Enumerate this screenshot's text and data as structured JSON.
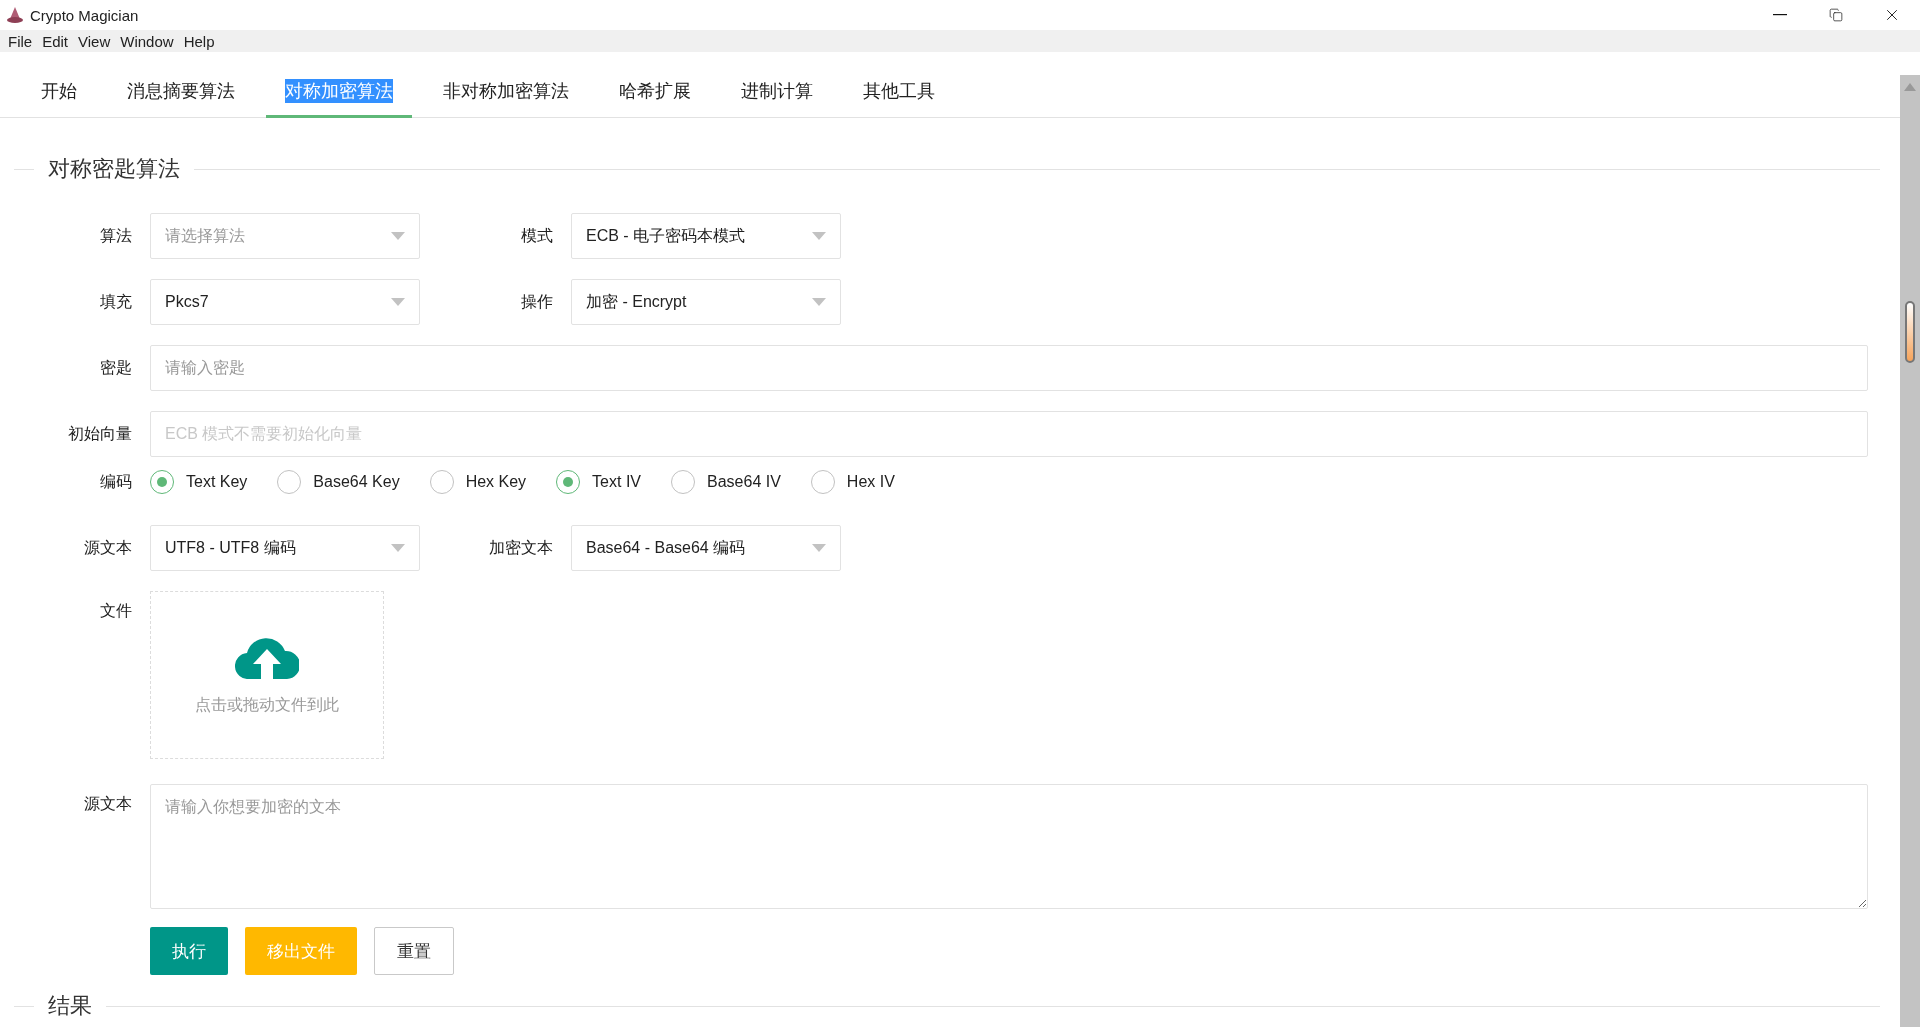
{
  "window": {
    "title": "Crypto Magician"
  },
  "menu": [
    "File",
    "Edit",
    "View",
    "Window",
    "Help"
  ],
  "tabs": [
    {
      "label": "开始",
      "selected": false
    },
    {
      "label": "消息摘要算法",
      "selected": false
    },
    {
      "label": "对称加密算法",
      "selected": true
    },
    {
      "label": "非对称加密算法",
      "selected": false
    },
    {
      "label": "哈希扩展",
      "selected": false
    },
    {
      "label": "进制计算",
      "selected": false
    },
    {
      "label": "其他工具",
      "selected": false
    }
  ],
  "section_title": "对称密匙算法",
  "algorithm": {
    "label": "算法",
    "placeholder": "请选择算法"
  },
  "mode": {
    "label": "模式",
    "value": "ECB - 电子密码本模式"
  },
  "padding": {
    "label": "填充",
    "value": "Pkcs7"
  },
  "operation": {
    "label": "操作",
    "value": "加密 - Encrypt"
  },
  "key": {
    "label": "密匙",
    "placeholder": "请输入密匙"
  },
  "iv": {
    "label": "初始向量",
    "placeholder": "ECB 模式不需要初始化向量",
    "disabled": true
  },
  "encoding": {
    "label": "编码",
    "groups": [
      {
        "options": [
          {
            "label": "Text Key",
            "selected": true
          },
          {
            "label": "Base64 Key",
            "selected": false
          },
          {
            "label": "Hex Key",
            "selected": false
          }
        ]
      },
      {
        "options": [
          {
            "label": "Text IV",
            "selected": true
          },
          {
            "label": "Base64 IV",
            "selected": false
          },
          {
            "label": "Hex IV",
            "selected": false
          }
        ]
      }
    ]
  },
  "source_encoding": {
    "label": "源文本",
    "value": "UTF8 - UTF8 编码"
  },
  "cipher_encoding": {
    "label": "加密文本",
    "value": "Base64 - Base64 编码"
  },
  "file": {
    "label": "文件",
    "hint": "点击或拖动文件到此"
  },
  "source_text": {
    "label": "源文本",
    "placeholder": "请输入你想要加密的文本"
  },
  "buttons": [
    {
      "label": "执行",
      "kind": "primary"
    },
    {
      "label": "移出文件",
      "kind": "warning"
    },
    {
      "label": "重置",
      "kind": "default"
    }
  ],
  "result_title": "结果"
}
